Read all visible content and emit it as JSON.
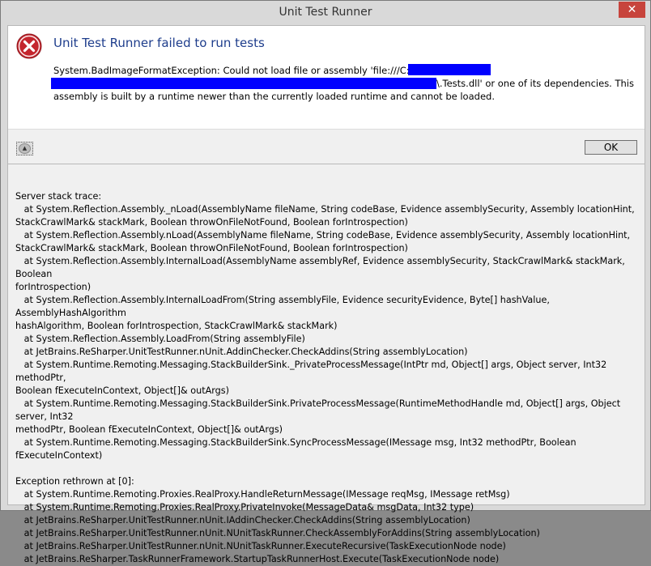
{
  "window": {
    "title": "Unit Test Runner"
  },
  "colors": {
    "heading": "#1e3d8c",
    "redaction": "#0000ff",
    "close_button": "#c7443c"
  },
  "icons": {
    "error": "error-circle-x-icon",
    "close": "close-icon",
    "details_toggle": "collapse-chevron-icon"
  },
  "message": {
    "heading": "Unit Test Runner failed to run tests",
    "line1": "System.BadImageFormatException: Could not load file or assembly 'file:///C:\\Code\\",
    "line2_suffix": "\\.Tests.dll' or one of its dependencies. This",
    "line3": "assembly is built by a runtime newer than the currently loaded runtime and cannot be loaded."
  },
  "buttons": {
    "ok": "OK"
  },
  "trace": [
    "Server stack trace:",
    "   at System.Reflection.Assembly._nLoad(AssemblyName fileName, String codeBase, Evidence assemblySecurity, Assembly locationHint,",
    "StackCrawlMark& stackMark, Boolean throwOnFileNotFound, Boolean forIntrospection)",
    "   at System.Reflection.Assembly.nLoad(AssemblyName fileName, String codeBase, Evidence assemblySecurity, Assembly locationHint,",
    "StackCrawlMark& stackMark, Boolean throwOnFileNotFound, Boolean forIntrospection)",
    "   at System.Reflection.Assembly.InternalLoad(AssemblyName assemblyRef, Evidence assemblySecurity, StackCrawlMark& stackMark, Boolean",
    "forIntrospection)",
    "   at System.Reflection.Assembly.InternalLoadFrom(String assemblyFile, Evidence securityEvidence, Byte[] hashValue, AssemblyHashAlgorithm",
    "hashAlgorithm, Boolean forIntrospection, StackCrawlMark& stackMark)",
    "   at System.Reflection.Assembly.LoadFrom(String assemblyFile)",
    "   at JetBrains.ReSharper.UnitTestRunner.nUnit.AddinChecker.CheckAddins(String assemblyLocation)",
    "   at System.Runtime.Remoting.Messaging.StackBuilderSink._PrivateProcessMessage(IntPtr md, Object[] args, Object server, Int32 methodPtr,",
    "Boolean fExecuteInContext, Object[]& outArgs)",
    "   at System.Runtime.Remoting.Messaging.StackBuilderSink.PrivateProcessMessage(RuntimeMethodHandle md, Object[] args, Object server, Int32",
    "methodPtr, Boolean fExecuteInContext, Object[]& outArgs)",
    "   at System.Runtime.Remoting.Messaging.StackBuilderSink.SyncProcessMessage(IMessage msg, Int32 methodPtr, Boolean fExecuteInContext)",
    "",
    "Exception rethrown at [0]:",
    "   at System.Runtime.Remoting.Proxies.RealProxy.HandleReturnMessage(IMessage reqMsg, IMessage retMsg)",
    "   at System.Runtime.Remoting.Proxies.RealProxy.PrivateInvoke(MessageData& msgData, Int32 type)",
    "   at JetBrains.ReSharper.UnitTestRunner.nUnit.IAddinChecker.CheckAddins(String assemblyLocation)",
    "   at JetBrains.ReSharper.UnitTestRunner.nUnit.NUnitTaskRunner.CheckAssemblyForAddins(String assemblyLocation)",
    "   at JetBrains.ReSharper.UnitTestRunner.nUnit.NUnitTaskRunner.ExecuteRecursive(TaskExecutionNode node)",
    "   at JetBrains.ReSharper.TaskRunnerFramework.StartupTaskRunnerHost.Execute(TaskExecutionNode node)"
  ]
}
